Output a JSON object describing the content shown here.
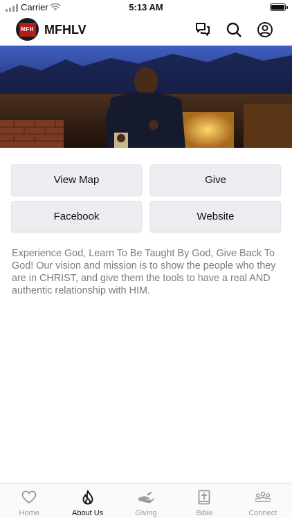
{
  "status_bar": {
    "carrier": "Carrier",
    "time": "5:13 AM",
    "signal_icon": "signal-icon",
    "wifi_icon": "wifi-icon",
    "battery_icon": "battery-icon",
    "battery_level": 1.0
  },
  "header": {
    "logo_text": "MFH",
    "title": "MFHLV",
    "icons": [
      "chat-icon",
      "search-icon",
      "account-icon"
    ]
  },
  "hero": {
    "image": "preacher-on-stage-photo"
  },
  "buttons": {
    "view_map": "View Map",
    "give": "Give",
    "facebook": "Facebook",
    "website": "Website"
  },
  "description": "Experience God, Learn To Be Taught By God, Give Back To God!  Our vision and mission is to show the people who they are in CHRIST, and give them the tools to have a real AND authentic relationship with HIM.",
  "tabs": [
    {
      "label": "Home",
      "icon": "heart-icon",
      "active": false
    },
    {
      "label": "About Us",
      "icon": "flame-icon",
      "active": true
    },
    {
      "label": "Giving",
      "icon": "giving-hand-icon",
      "active": false
    },
    {
      "label": "Bible",
      "icon": "bible-icon",
      "active": false
    },
    {
      "label": "Connect",
      "icon": "people-icon",
      "active": false
    }
  ],
  "colors": {
    "text": "#111111",
    "muted_text": "#7b7b7b",
    "button_bg": "#ecedf0",
    "inactive_tab": "#9a9a9a",
    "logo_red": "#b51d1d"
  }
}
